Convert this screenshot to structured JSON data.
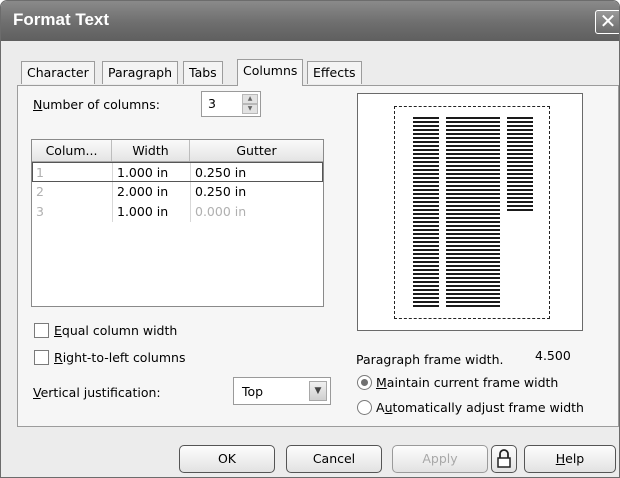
{
  "window": {
    "title": "Format Text",
    "close_glyph": "✕"
  },
  "tabs": [
    {
      "label": "Character",
      "active": false
    },
    {
      "label": "Paragraph",
      "active": false
    },
    {
      "label": "Tabs",
      "active": false
    },
    {
      "label": "Columns",
      "active": true
    },
    {
      "label": "Effects",
      "active": false
    }
  ],
  "columns_tab": {
    "number_of_columns": {
      "label_mnemonic": "N",
      "label_rest": "umber of columns:",
      "value": "3"
    },
    "table": {
      "headers": [
        "Colum...",
        "Width",
        "Gutter"
      ],
      "rows": [
        {
          "column": "1",
          "width": "1.000 in",
          "gutter": "0.250 in",
          "selected": true,
          "gutter_disabled": false
        },
        {
          "column": "2",
          "width": "2.000 in",
          "gutter": "0.250 in",
          "selected": false,
          "gutter_disabled": false
        },
        {
          "column": "3",
          "width": "1.000 in",
          "gutter": "0.000 in",
          "selected": false,
          "gutter_disabled": true
        }
      ]
    },
    "equal_column_width": {
      "mnemonic": "E",
      "rest": "qual column width",
      "checked": false
    },
    "right_to_left_columns": {
      "mnemonic": "R",
      "rest": "ight-to-left columns",
      "checked": false
    },
    "vertical_justification": {
      "label_mnemonic": "V",
      "label_rest": "ertical justification:",
      "value": "Top"
    },
    "paragraph_frame_width": {
      "label": "Paragraph frame width.",
      "value": "4.500"
    },
    "frame_options": {
      "maintain": {
        "mnemonic": "M",
        "rest": "aintain current frame width",
        "selected": true
      },
      "auto_prefix": "A",
      "auto_mnemonic": "u",
      "auto_rest": "tomatically adjust frame width"
    }
  },
  "buttons": {
    "ok": "OK",
    "cancel": "Cancel",
    "apply": "Apply",
    "help_mnemonic": "H",
    "help_rest": "elp",
    "lock_icon": "lock-icon"
  },
  "colors": {
    "title_bar": "#6e6e6e",
    "dialog_bg": "#ececec",
    "disabled_text": "#b0b0b0"
  }
}
